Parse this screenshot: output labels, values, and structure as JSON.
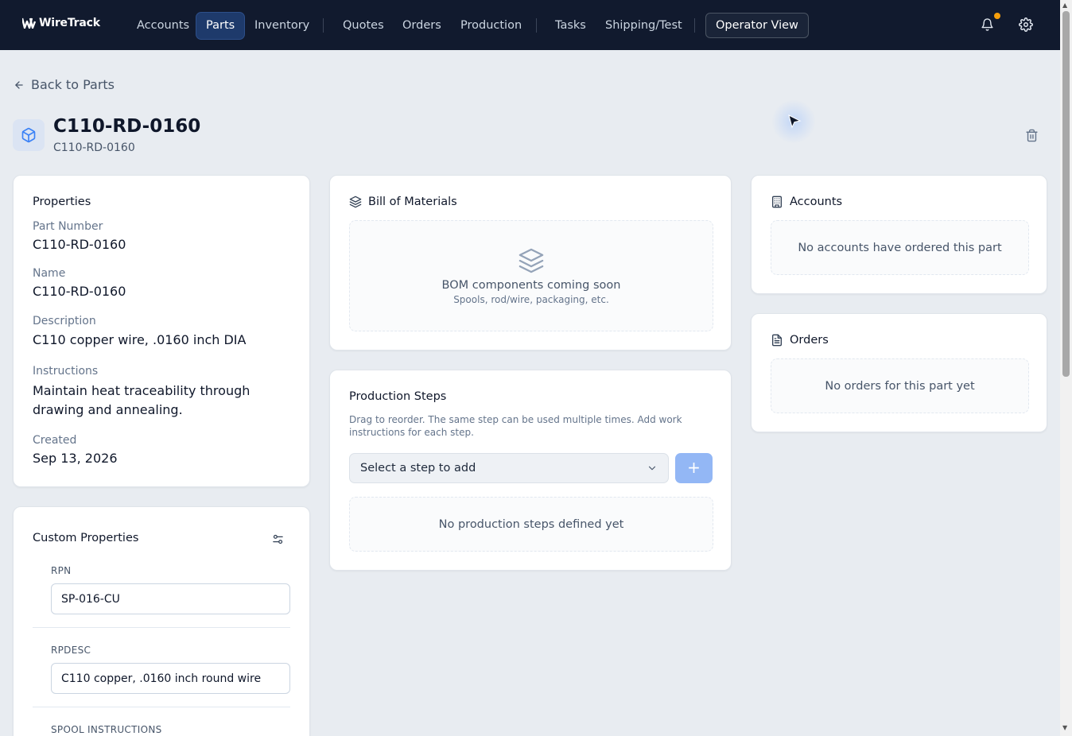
{
  "nav": {
    "logo": "WireTrack",
    "items": [
      {
        "label": "Accounts"
      },
      {
        "label": "Parts"
      },
      {
        "label": "Inventory"
      },
      {
        "label": "Quotes"
      },
      {
        "label": "Orders"
      },
      {
        "label": "Production"
      },
      {
        "label": "Tasks"
      },
      {
        "label": "Shipping/Test"
      }
    ],
    "operator_view": "Operator View"
  },
  "header": {
    "back_label": "Back to Parts",
    "title": "C110-RD-0160",
    "subtitle": "C110-RD-0160"
  },
  "properties": {
    "title": "Properties",
    "fields": [
      {
        "label": "Part Number",
        "value": "C110-RD-0160"
      },
      {
        "label": "Name",
        "value": "C110-RD-0160"
      },
      {
        "label": "Description",
        "value": "C110 copper wire, .0160 inch DIA"
      },
      {
        "label": "Instructions",
        "value": "Maintain heat traceability through drawing and annealing."
      },
      {
        "label": "Created",
        "value": "Sep 13, 2026"
      }
    ]
  },
  "custom_properties": {
    "title": "Custom Properties",
    "fields": [
      {
        "label": "RPN",
        "value": "SP-016-CU"
      },
      {
        "label": "RPDESC",
        "value": "C110 copper, .0160 inch round wire"
      },
      {
        "label": "SPOOL INSTRUCTIONS",
        "value": ""
      }
    ]
  },
  "bom": {
    "title": "Bill of Materials",
    "empty_text": "BOM components coming soon",
    "empty_sub": "Spools, rod/wire, packaging, etc."
  },
  "production_steps": {
    "title": "Production Steps",
    "help": "Drag to reorder. The same step can be used multiple times. Add work instructions for each step.",
    "select_placeholder": "Select a step to add",
    "add_label": "+",
    "empty_text": "No production steps defined yet"
  },
  "accounts": {
    "title": "Accounts",
    "empty_text": "No accounts have ordered this part"
  },
  "orders": {
    "title": "Orders",
    "empty_text": "No orders for this part yet"
  },
  "colors": {
    "nav_bg": "#111a2e",
    "accent": "#1e3a6b",
    "notification": "#f59e0b",
    "add_button": "#93b7f5"
  }
}
